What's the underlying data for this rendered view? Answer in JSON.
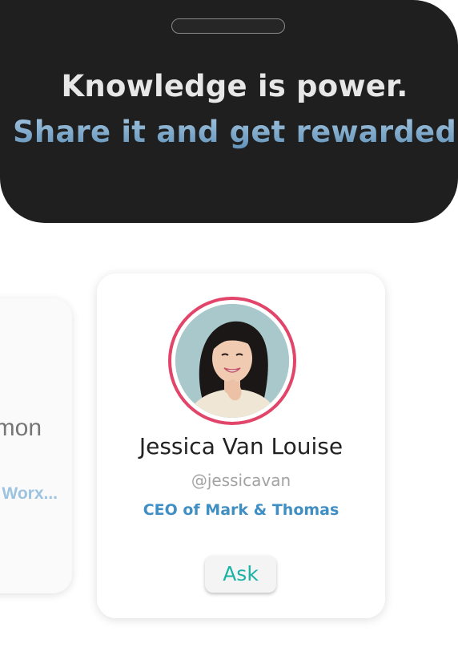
{
  "banner": {
    "headline": "Knowledge is power.",
    "subheadline": "Share it and get rewarded"
  },
  "cards": {
    "previous": {
      "name_fragment": "mon",
      "role_fragment": "Worx..."
    },
    "current": {
      "name": "Jessica Van Louise",
      "handle": "@jessicavan",
      "role": "CEO of Mark & Thomas",
      "ask_label": "Ask",
      "avatar_ring_color": "#e2456a",
      "avatar_icon": "profile-photo"
    }
  },
  "colors": {
    "banner_bg": "#1f1f1f",
    "subheadline": "#8fb6d5",
    "role_text": "#3f8fc4",
    "ask_text": "#19b3a6"
  }
}
